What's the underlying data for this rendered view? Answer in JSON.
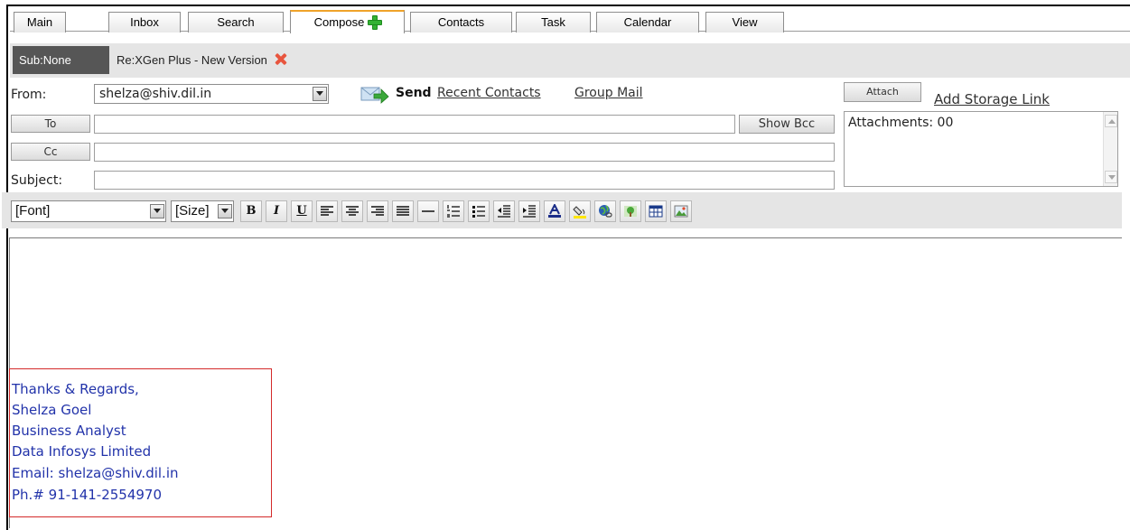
{
  "tabs": [
    {
      "label": "Main",
      "active": false
    },
    {
      "label": "Inbox",
      "active": false
    },
    {
      "label": "Search",
      "active": false
    },
    {
      "label": "Compose",
      "active": true
    },
    {
      "label": "Contacts",
      "active": false
    },
    {
      "label": "Task",
      "active": false
    },
    {
      "label": "Calendar",
      "active": false
    },
    {
      "label": "View",
      "active": false
    }
  ],
  "subtabs": {
    "current": "Sub:None",
    "document": "Re:XGen Plus - New Version"
  },
  "compose": {
    "from_label": "From:",
    "from_value": "shelza@shiv.dil.in",
    "send_label": "Send",
    "recent_contacts": "Recent Contacts",
    "group_mail": "Group Mail",
    "attach_button": "Attach",
    "add_storage_link": "Add Storage Link",
    "to_button": "To",
    "cc_button": "Cc",
    "subject_label": "Subject:",
    "show_bcc": "Show Bcc",
    "attachments_text": "Attachments: 00",
    "to_value": "",
    "cc_value": "",
    "subject_value": ""
  },
  "toolbar": {
    "font_select": "[Font]",
    "size_select": "[Size]",
    "bold": "B",
    "italic": "I",
    "underline": "U"
  },
  "signature": {
    "lines": [
      "Thanks & Regards,",
      "Shelza Goel",
      "Business Analyst",
      "Data Infosys Limited",
      "Email: shelza@shiv.dil.in",
      "Ph.# 91-141-2554970"
    ]
  },
  "colors": {
    "active_tab_accent": "#f0a32a",
    "signature_text": "#2233aa",
    "signature_highlight_border": "#d42a2a",
    "close_icon": "#e8553e",
    "compose_plus_icon": "#34b233"
  }
}
